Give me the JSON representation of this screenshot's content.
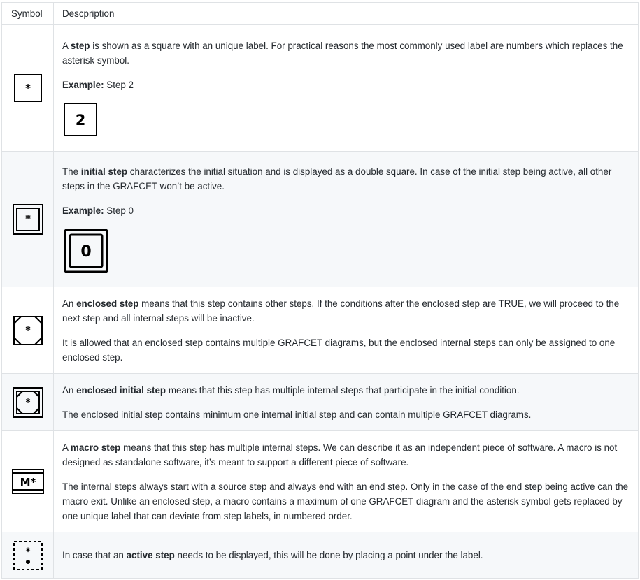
{
  "header": {
    "symbol": "Symbol",
    "description": "Descpription"
  },
  "rows": [
    {
      "symbol_icon": "step-icon",
      "p1": {
        "pre": "A ",
        "bold": "step",
        "post": " is shown as a square with an unique label. For practical reasons the most commonly used label are numbers which replaces the asterisk symbol."
      },
      "symbol_label": "*",
      "example_label": "Example:",
      "example_text": " Step 2",
      "example_symbol": "2"
    },
    {
      "symbol_icon": "initial-step-icon",
      "p1": {
        "pre": "The ",
        "bold": "initial step",
        "post": " characterizes the initial situation and is displayed as a double square. In case of the initial step being active, all other steps in the GRAFCET won’t be active."
      },
      "symbol_label": "*",
      "example_label": "Example:",
      "example_text": " Step 0",
      "example_symbol": "0"
    },
    {
      "symbol_icon": "enclosed-step-icon",
      "p1": {
        "pre": "An ",
        "bold": "enclosed step",
        "post": " means that this step contains other steps. If the conditions after the enclosed step are TRUE, we will proceed to the next step and all internal steps will be inactive."
      },
      "p2": "It is allowed that an enclosed step contains multiple GRAFCET diagrams, but the enclosed internal steps can only be assigned to one enclosed step.",
      "symbol_label": "*"
    },
    {
      "symbol_icon": "enclosed-initial-step-icon",
      "p1": {
        "pre": "An ",
        "bold": "enclosed initial step",
        "post": " means that this step has multiple internal steps that participate in the initial condition."
      },
      "p2": "The enclosed initial step contains minimum one internal initial step and can contain multiple GRAFCET diagrams.",
      "symbol_label": "*"
    },
    {
      "symbol_icon": "macro-step-icon",
      "p1": {
        "pre": "A ",
        "bold": "macro step",
        "post": " means that this step has multiple internal steps. We can describe it as an independent piece of software. A macro is not designed as standalone software, it’s meant to support a different piece of software."
      },
      "p2": "The internal steps always start with a source step and always end with an end step. Only in the case of the end step being active can the macro exit. Unlike an enclosed step, a macro contains a maximum of one GRAFCET diagram and the asterisk symbol gets replaced by one unique label that can deviate from step labels, in numbered order.",
      "symbol_label": "M*"
    },
    {
      "symbol_icon": "active-step-icon",
      "p1": {
        "pre": "In case that an ",
        "bold": "active step",
        "post": " needs to be displayed, this will be done by placing a point under the label."
      },
      "symbol_label": "*"
    }
  ]
}
